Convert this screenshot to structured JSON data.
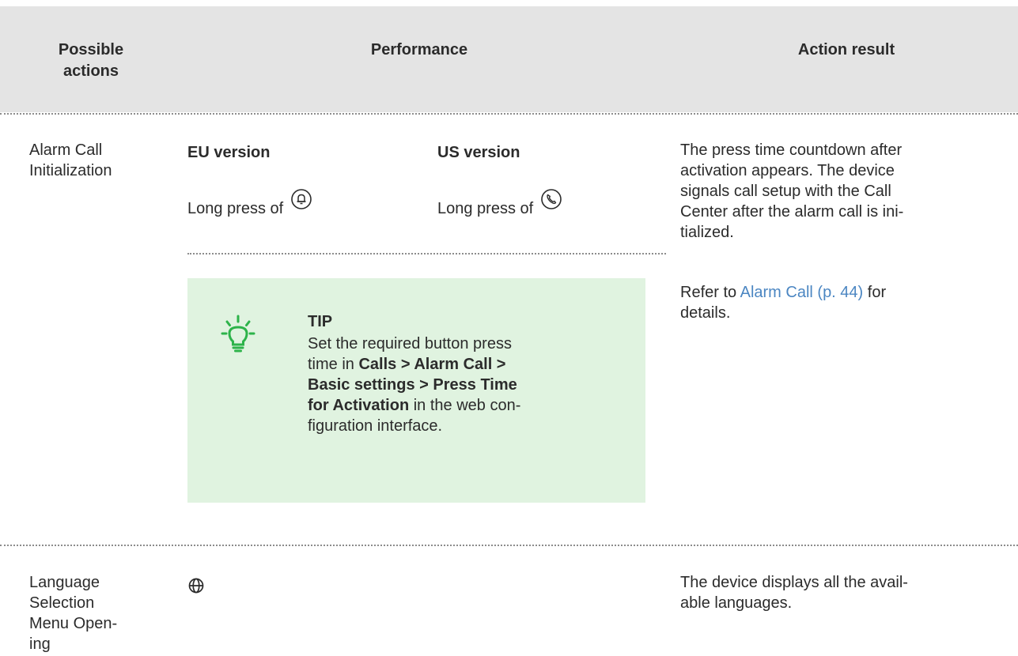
{
  "header": {
    "col1": "Possible actions",
    "col2": "Performance",
    "col3": "Action result"
  },
  "row1": {
    "action_line1": "Alarm Call",
    "action_line2": "Initialization",
    "eu_title": "EU version",
    "us_title": "US version",
    "eu_text": "Long press of",
    "us_text": "Long press of",
    "eu_icon": "bell-button-icon",
    "us_icon": "phone-button-icon",
    "result_lines": [
      "The press time countdown after",
      "activation appears. The device",
      "signals call setup with the Call",
      "Center after the alarm call is ini-",
      "tialized."
    ],
    "refer_prefix": "Refer to",
    "refer_link": "Alarm Call (p. 44)",
    "refer_suffix": "for",
    "refer_line2": "details.",
    "tip": {
      "title": "TIP",
      "icon": "lightbulb-icon",
      "line1": "Set the required button press",
      "line2_a": "time in ",
      "line2_b": "Calls > Alarm Call >",
      "line3": "Basic settings > Press Time",
      "line4_a": "for Activation",
      "line4_b": " in the web con-",
      "line5": "figuration interface."
    }
  },
  "row2": {
    "action_lines": [
      "Language",
      "Selection",
      "Menu Open-",
      "ing"
    ],
    "icon": "globe-icon",
    "result_line1": "The device displays all the avail-",
    "result_line2": "able languages."
  },
  "colors": {
    "header_bg": "#e4e4e4",
    "tip_bg": "#e0f3e0",
    "tip_icon": "#2db34a",
    "link": "#4b86c2"
  }
}
